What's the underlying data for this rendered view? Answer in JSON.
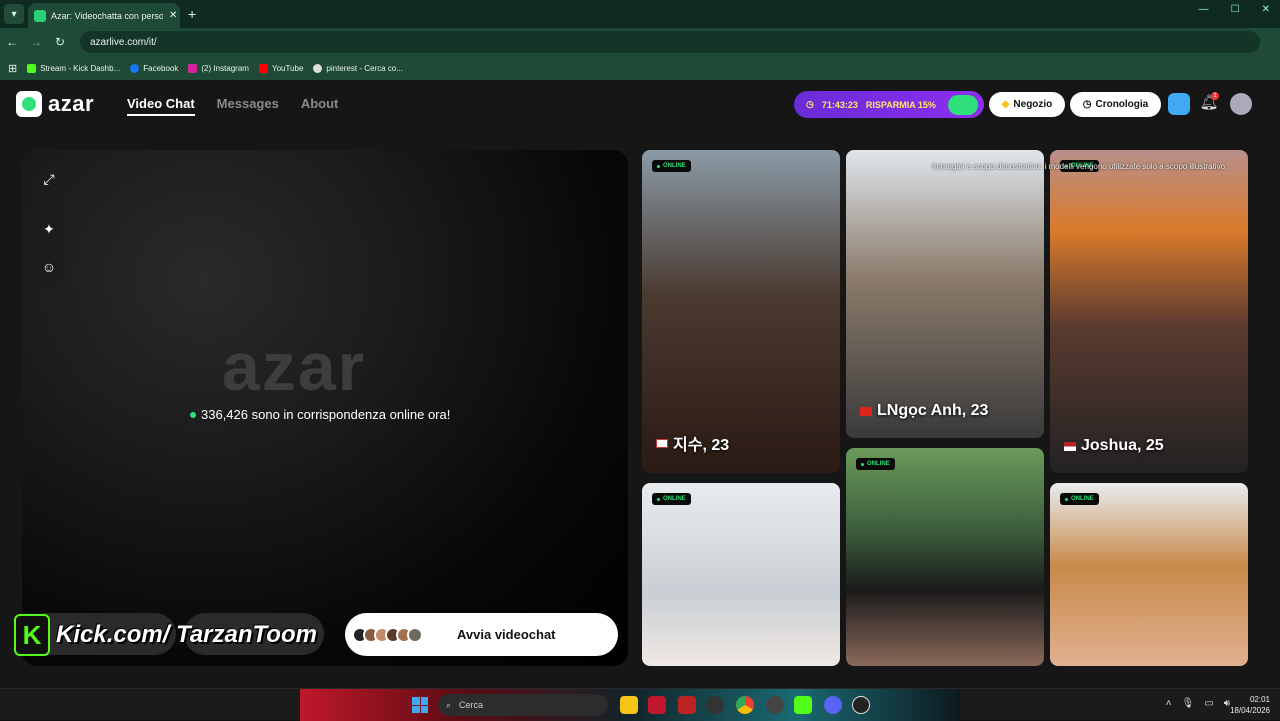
{
  "browser": {
    "tab_title": "Azar: Videochatta con persone",
    "tab_close": "✕",
    "new_tab": "+",
    "url": "azarlive.com/it/",
    "bookmarks": [
      {
        "label": "Stream - Kick Dashb...",
        "color": "#53fc18"
      },
      {
        "label": "Facebook",
        "color": "#1877f2"
      },
      {
        "label": "(2) Instagram",
        "color": "#d6249f"
      },
      {
        "label": "YouTube",
        "color": "#ff0000"
      },
      {
        "label": "pinterest - Cerca co...",
        "color": "#dddddd"
      }
    ]
  },
  "header": {
    "logo_text": "azar",
    "nav": [
      "Video Chat",
      "Messages",
      "About"
    ],
    "promo_timer": "71:43:23",
    "promo_label": "RISPARMIA 15%",
    "shop_label": "Negozio",
    "history_label": "Cronologia",
    "notification_count": "1"
  },
  "stage": {
    "watermark": "azar",
    "online_text": "336,426 sono in corrispondenza online ora!",
    "start_label": "Avvia videochat",
    "kick_overlay": "Kick.com/ TarzanToom",
    "kick_letter": "K"
  },
  "grid": {
    "disclaimer": "Immagini a scopo dimostrativo: i modelli vengono utilizzate solo a scopo illustrativo.",
    "online_badge": "ONLINE",
    "profiles": [
      {
        "name": "지수, 23",
        "flag": "kr"
      },
      {
        "name": "LNgọc Anh, 23",
        "flag": "vn"
      },
      {
        "name": "Joshua, 25",
        "flag": "us"
      }
    ]
  },
  "taskbar": {
    "search_placeholder": "Cerca",
    "time": "02:01",
    "date": "18/04/2026"
  }
}
